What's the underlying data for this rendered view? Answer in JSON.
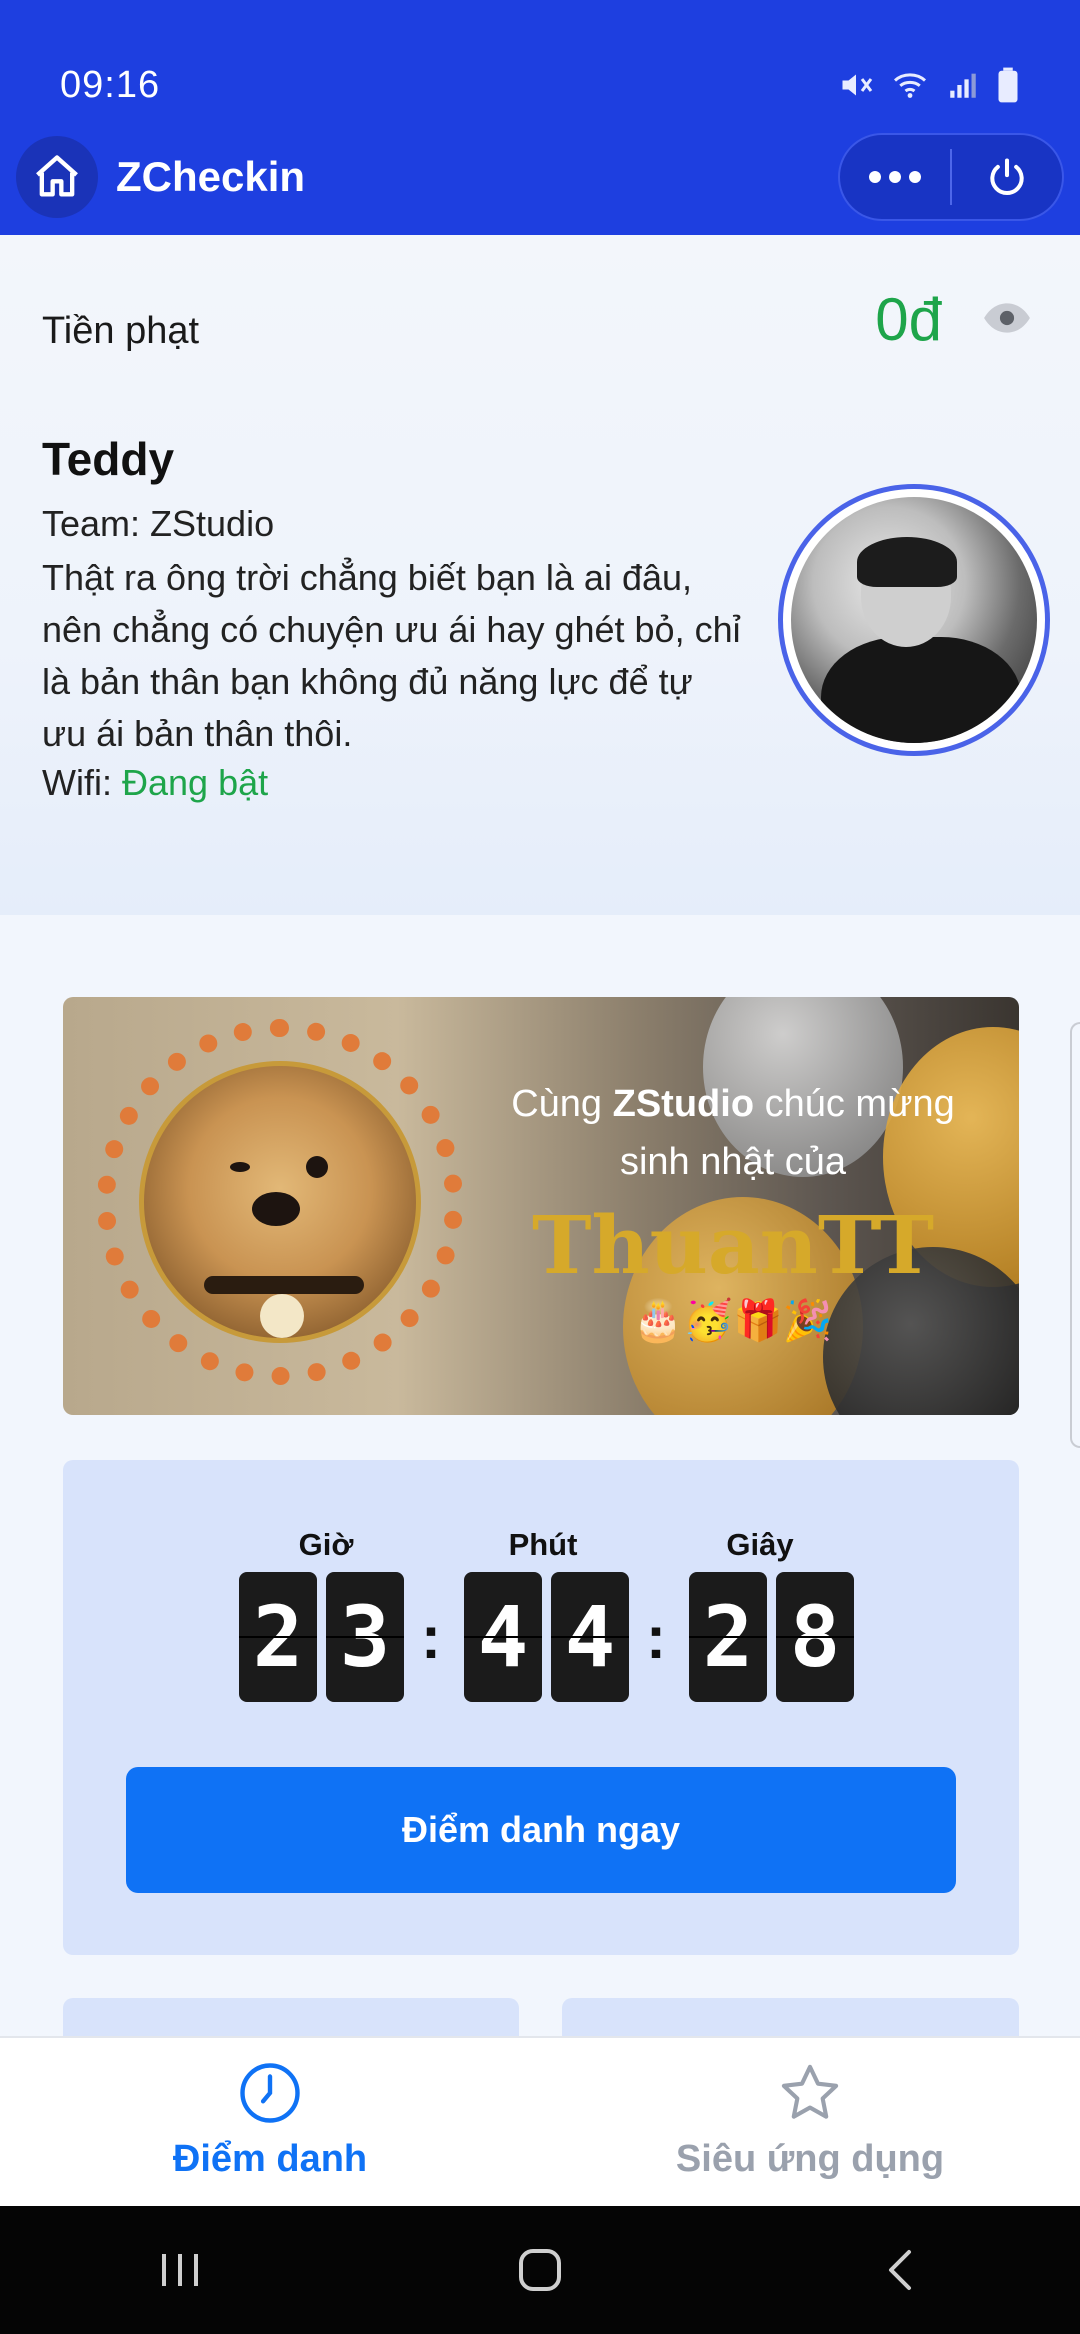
{
  "status_bar": {
    "time": "09:16"
  },
  "app": {
    "title": "ZCheckin"
  },
  "fine": {
    "label": "Tiền phạt",
    "value": "0đ"
  },
  "user": {
    "name": "Teddy",
    "team": "Team: ZStudio",
    "quote": "Thật ra ông trời chẳng biết bạn là ai đâu, nên chẳng có chuyện ưu ái hay ghét bỏ, chỉ là bản thân bạn không đủ năng lực để tự ưu ái bản thân thôi.",
    "wifi_label": "Wifi:",
    "wifi_status": "Đang bật"
  },
  "banner": {
    "line1_prefix": "Cùng",
    "line1_brand": "ZStudio",
    "line1_suffix": "chúc mừng",
    "line2": "sinh nhật của",
    "name": "ThuanTT",
    "emoji": "🎂🥳🎁🎉"
  },
  "countdown": {
    "hours_label": "Giờ",
    "minutes_label": "Phút",
    "seconds_label": "Giây",
    "h1": "2",
    "h2": "3",
    "m1": "4",
    "m2": "4",
    "s1": "2",
    "s2": "8",
    "separator": ":",
    "button_label": "Điểm danh ngay"
  },
  "bottom_nav": {
    "items": [
      {
        "label": "Điểm danh",
        "icon": "clock-icon",
        "active": true
      },
      {
        "label": "Siêu ứng dụng",
        "icon": "star-icon",
        "active": false
      }
    ]
  },
  "colors": {
    "header_bg": "#1e3fe0",
    "accent": "#0f72f5",
    "success": "#1ea54a",
    "card_bg": "#d8e3fb"
  }
}
